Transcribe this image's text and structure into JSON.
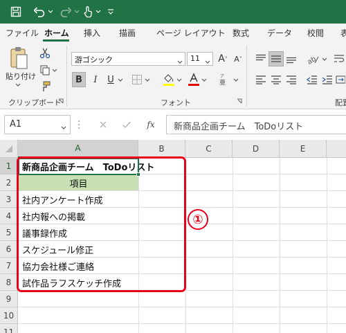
{
  "title_bar": {
    "icons": [
      "save-icon",
      "undo-icon",
      "redo-icon",
      "touch-mode-icon",
      "customize-qat-icon"
    ]
  },
  "ribbon_tabs": [
    "ファイル",
    "ホーム",
    "挿入",
    "描画",
    "ページ レイアウト",
    "数式",
    "データ",
    "校閲",
    "表"
  ],
  "active_tab": "ホーム",
  "clipboard": {
    "paste_label": "貼り付け",
    "group_label": "クリップボード"
  },
  "font": {
    "name": "游ゴシック",
    "size": "11",
    "grow": "A",
    "shrink": "A",
    "bold": "B",
    "italic": "I",
    "underline": "U",
    "group_label": "フォント",
    "font_color": "#e00000",
    "fill_color": "#ffff00"
  },
  "alignment": {
    "group_label": "配置"
  },
  "formula_bar": {
    "name_box": "A1",
    "fx": "fx",
    "content": "新商品企画チーム　ToDoリスト"
  },
  "columns": [
    "A",
    "B",
    "C",
    "D",
    "E"
  ],
  "rows": [
    "1",
    "2",
    "3",
    "4",
    "5",
    "6",
    "7",
    "8",
    "9",
    "10",
    "11"
  ],
  "cells": {
    "A1": "新商品企画チーム　ToDoリスト",
    "A2": "項目",
    "A3": "社内アンケート作成",
    "A4": "社内報への掲載",
    "A5": "議事録作成",
    "A6": "スケジュール修正",
    "A7": "協力会社様ご連絡",
    "A8": "試作品ラフスケッチ作成"
  },
  "callout": {
    "number": "①",
    "color": "#e8001c"
  },
  "colors": {
    "excel_green": "#217346",
    "header_fill": "#c6e0b4"
  }
}
